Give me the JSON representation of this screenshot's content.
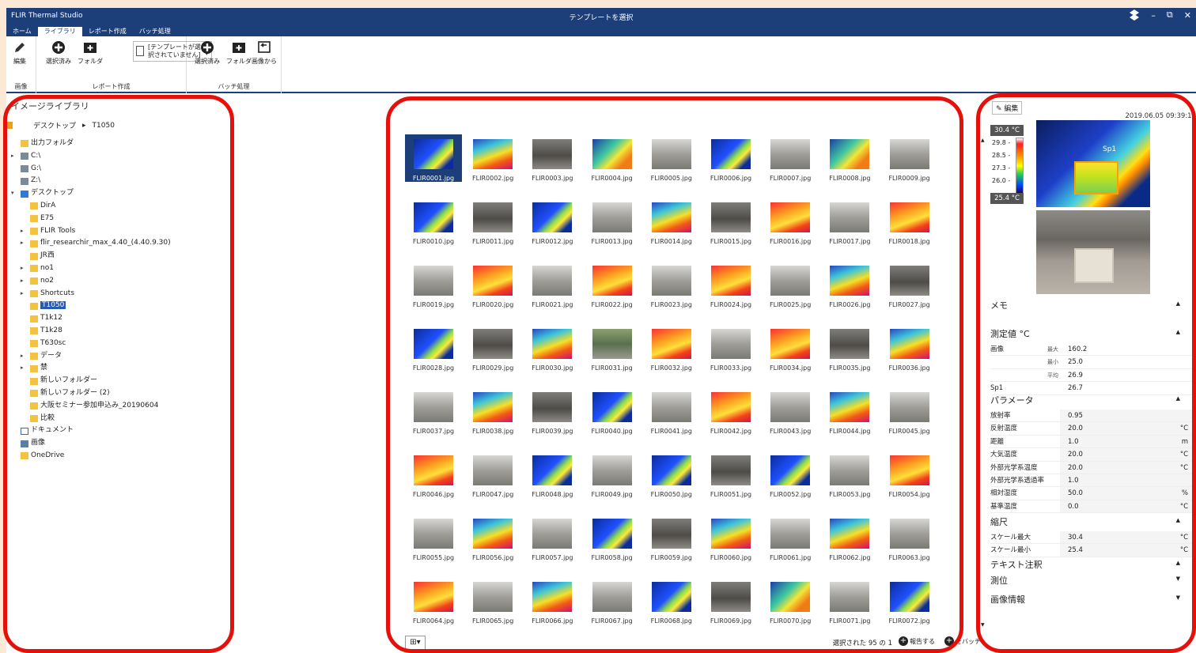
{
  "window": {
    "app_name": "FLIR Thermal Studio",
    "title": "テンプレートを選択",
    "controls": [
      "–",
      "⧉",
      "✕"
    ]
  },
  "menu": {
    "tabs": [
      "ホーム",
      "ライブラリ",
      "レポート作成",
      "バッチ処理"
    ],
    "active_index": 1
  },
  "ribbon": {
    "image_group": {
      "label": "画像",
      "edit": "編集"
    },
    "report_group": {
      "label": "レポート作成",
      "selected": "選択済み",
      "folder": "フォルダ",
      "template_line1": "[テンプレートが選",
      "template_line2": "択されていません]"
    },
    "batch_group": {
      "label": "バッチ処理",
      "selected": "選択済み",
      "folder": "フォルダ",
      "from_image": "画像から"
    }
  },
  "library": {
    "title": "イメージライブラリ",
    "breadcrumb": [
      "デスクトップ",
      "T1050"
    ]
  },
  "tree": [
    {
      "label": "出力フォルダ",
      "indent": 1,
      "arrow": "",
      "icon": "folder",
      "selected": false
    },
    {
      "label": "C:\\",
      "indent": 1,
      "arrow": "▸",
      "icon": "drive",
      "selected": false
    },
    {
      "label": "G:\\",
      "indent": 1,
      "arrow": "",
      "icon": "drive",
      "selected": false
    },
    {
      "label": "Z:\\",
      "indent": 1,
      "arrow": "",
      "icon": "drive",
      "selected": false
    },
    {
      "label": "デスクトップ",
      "indent": 1,
      "arrow": "▾",
      "icon": "desktop",
      "selected": false
    },
    {
      "label": "DirA",
      "indent": 2,
      "arrow": "",
      "icon": "folder",
      "selected": false
    },
    {
      "label": "E75",
      "indent": 2,
      "arrow": "",
      "icon": "folder",
      "selected": false
    },
    {
      "label": "FLIR Tools",
      "indent": 2,
      "arrow": "▸",
      "icon": "folder",
      "selected": false
    },
    {
      "label": "flir_researchir_max_4.40_(4.40.9.30)",
      "indent": 2,
      "arrow": "▸",
      "icon": "folder",
      "selected": false
    },
    {
      "label": "JR西",
      "indent": 2,
      "arrow": "",
      "icon": "folder",
      "selected": false
    },
    {
      "label": "no1",
      "indent": 2,
      "arrow": "▸",
      "icon": "folder",
      "selected": false
    },
    {
      "label": "no2",
      "indent": 2,
      "arrow": "▸",
      "icon": "folder",
      "selected": false
    },
    {
      "label": "Shortcuts",
      "indent": 2,
      "arrow": "▸",
      "icon": "folder",
      "selected": false
    },
    {
      "label": "T1050",
      "indent": 2,
      "arrow": "",
      "icon": "folder",
      "selected": true
    },
    {
      "label": "T1k12",
      "indent": 2,
      "arrow": "",
      "icon": "folder",
      "selected": false
    },
    {
      "label": "T1k28",
      "indent": 2,
      "arrow": "",
      "icon": "folder",
      "selected": false
    },
    {
      "label": "T630sc",
      "indent": 2,
      "arrow": "",
      "icon": "folder",
      "selected": false
    },
    {
      "label": "データ",
      "indent": 2,
      "arrow": "▸",
      "icon": "folder",
      "selected": false
    },
    {
      "label": "禁",
      "indent": 2,
      "arrow": "▸",
      "icon": "folder",
      "selected": false
    },
    {
      "label": "新しいフォルダー",
      "indent": 2,
      "arrow": "",
      "icon": "folder",
      "selected": false
    },
    {
      "label": "新しいフォルダー (2)",
      "indent": 2,
      "arrow": "",
      "icon": "folder",
      "selected": false
    },
    {
      "label": "大阪セミナー参加申込み_20190604",
      "indent": 2,
      "arrow": "",
      "icon": "folder",
      "selected": false
    },
    {
      "label": "比較",
      "indent": 2,
      "arrow": "",
      "icon": "folder",
      "selected": false
    },
    {
      "label": "ドキュメント",
      "indent": 1,
      "arrow": "",
      "icon": "doc",
      "selected": false
    },
    {
      "label": "画像",
      "indent": 1,
      "arrow": "",
      "icon": "pictures",
      "selected": false
    },
    {
      "label": "OneDrive",
      "indent": 1,
      "arrow": "",
      "icon": "folder",
      "selected": false
    }
  ],
  "thumbnails": [
    {
      "name": "FLIR0001.jpg",
      "kind": "thermal-blue"
    },
    {
      "name": "FLIR0002.jpg",
      "kind": "thermal-mix"
    },
    {
      "name": "FLIR0003.jpg",
      "kind": "photo-dark"
    },
    {
      "name": "FLIR0004.jpg",
      "kind": "thermal-green"
    },
    {
      "name": "FLIR0005.jpg",
      "kind": "photo-grey"
    },
    {
      "name": "FLIR0006.jpg",
      "kind": "thermal-blue"
    },
    {
      "name": "FLIR0007.jpg",
      "kind": "photo-grey"
    },
    {
      "name": "FLIR0008.jpg",
      "kind": "thermal-green"
    },
    {
      "name": "FLIR0009.jpg",
      "kind": "photo-grey"
    },
    {
      "name": "FLIR0010.jpg",
      "kind": "thermal-blue"
    },
    {
      "name": "FLIR0011.jpg",
      "kind": "photo-dark"
    },
    {
      "name": "FLIR0012.jpg",
      "kind": "thermal-blue"
    },
    {
      "name": "FLIR0013.jpg",
      "kind": "photo-grey"
    },
    {
      "name": "FLIR0014.jpg",
      "kind": "thermal-mix"
    },
    {
      "name": "FLIR0015.jpg",
      "kind": "photo-dark"
    },
    {
      "name": "FLIR0016.jpg",
      "kind": "thermal-red"
    },
    {
      "name": "FLIR0017.jpg",
      "kind": "photo-grey"
    },
    {
      "name": "FLIR0018.jpg",
      "kind": "thermal-red"
    },
    {
      "name": "FLIR0019.jpg",
      "kind": "photo-grey"
    },
    {
      "name": "FLIR0020.jpg",
      "kind": "thermal-red"
    },
    {
      "name": "FLIR0021.jpg",
      "kind": "photo-grey"
    },
    {
      "name": "FLIR0022.jpg",
      "kind": "thermal-red"
    },
    {
      "name": "FLIR0023.jpg",
      "kind": "photo-grey"
    },
    {
      "name": "FLIR0024.jpg",
      "kind": "thermal-red"
    },
    {
      "name": "FLIR0025.jpg",
      "kind": "photo-grey"
    },
    {
      "name": "FLIR0026.jpg",
      "kind": "thermal-mix"
    },
    {
      "name": "FLIR0027.jpg",
      "kind": "photo-dark"
    },
    {
      "name": "FLIR0028.jpg",
      "kind": "thermal-blue"
    },
    {
      "name": "FLIR0029.jpg",
      "kind": "photo-dark"
    },
    {
      "name": "FLIR0030.jpg",
      "kind": "thermal-mix"
    },
    {
      "name": "FLIR0031.jpg",
      "kind": "photo-green"
    },
    {
      "name": "FLIR0032.jpg",
      "kind": "thermal-red"
    },
    {
      "name": "FLIR0033.jpg",
      "kind": "photo-grey"
    },
    {
      "name": "FLIR0034.jpg",
      "kind": "thermal-red"
    },
    {
      "name": "FLIR0035.jpg",
      "kind": "photo-dark"
    },
    {
      "name": "FLIR0036.jpg",
      "kind": "thermal-mix"
    },
    {
      "name": "FLIR0037.jpg",
      "kind": "photo-grey"
    },
    {
      "name": "FLIR0038.jpg",
      "kind": "thermal-mix"
    },
    {
      "name": "FLIR0039.jpg",
      "kind": "photo-dark"
    },
    {
      "name": "FLIR0040.jpg",
      "kind": "thermal-blue"
    },
    {
      "name": "FLIR0041.jpg",
      "kind": "photo-grey"
    },
    {
      "name": "FLIR0042.jpg",
      "kind": "thermal-red"
    },
    {
      "name": "FLIR0043.jpg",
      "kind": "photo-grey"
    },
    {
      "name": "FLIR0044.jpg",
      "kind": "thermal-mix"
    },
    {
      "name": "FLIR0045.jpg",
      "kind": "photo-grey"
    },
    {
      "name": "FLIR0046.jpg",
      "kind": "thermal-red"
    },
    {
      "name": "FLIR0047.jpg",
      "kind": "photo-grey"
    },
    {
      "name": "FLIR0048.jpg",
      "kind": "thermal-blue"
    },
    {
      "name": "FLIR0049.jpg",
      "kind": "photo-grey"
    },
    {
      "name": "FLIR0050.jpg",
      "kind": "thermal-blue"
    },
    {
      "name": "FLIR0051.jpg",
      "kind": "photo-dark"
    },
    {
      "name": "FLIR0052.jpg",
      "kind": "thermal-blue"
    },
    {
      "name": "FLIR0053.jpg",
      "kind": "photo-grey"
    },
    {
      "name": "FLIR0054.jpg",
      "kind": "thermal-red"
    },
    {
      "name": "FLIR0055.jpg",
      "kind": "photo-grey"
    },
    {
      "name": "FLIR0056.jpg",
      "kind": "thermal-mix"
    },
    {
      "name": "FLIR0057.jpg",
      "kind": "photo-grey"
    },
    {
      "name": "FLIR0058.jpg",
      "kind": "thermal-blue"
    },
    {
      "name": "FLIR0059.jpg",
      "kind": "photo-dark"
    },
    {
      "name": "FLIR0060.jpg",
      "kind": "thermal-mix"
    },
    {
      "name": "FLIR0061.jpg",
      "kind": "photo-grey"
    },
    {
      "name": "FLIR0062.jpg",
      "kind": "thermal-mix"
    },
    {
      "name": "FLIR0063.jpg",
      "kind": "photo-grey"
    },
    {
      "name": "FLIR0064.jpg",
      "kind": "thermal-red"
    },
    {
      "name": "FLIR0065.jpg",
      "kind": "photo-grey"
    },
    {
      "name": "FLIR0066.jpg",
      "kind": "thermal-mix"
    },
    {
      "name": "FLIR0067.jpg",
      "kind": "photo-grey"
    },
    {
      "name": "FLIR0068.jpg",
      "kind": "thermal-blue"
    },
    {
      "name": "FLIR0069.jpg",
      "kind": "photo-dark"
    },
    {
      "name": "FLIR0070.jpg",
      "kind": "thermal-green"
    },
    {
      "name": "FLIR0071.jpg",
      "kind": "photo-grey"
    },
    {
      "name": "FLIR0072.jpg",
      "kind": "thermal-blue"
    }
  ],
  "bottom": {
    "view_icon": "grid-view-icon",
    "selection_text": "選択された 95 の 1",
    "add_report": "報告する",
    "add_batch": "をバッチ"
  },
  "details": {
    "edit_label": "編集",
    "timestamp": "2019.06.05 09:39:13",
    "scale": {
      "max": "30.4 °C",
      "min": "25.4 °C",
      "ticks": [
        "29.8 -",
        "28.5 -",
        "27.3 -",
        "26.0 -"
      ]
    },
    "spot_label": "Sp1",
    "memo_title": "メモ",
    "measurements_title": "測定値 °C",
    "measurements": [
      {
        "name": "画像",
        "sub": "最大",
        "value": "160.2"
      },
      {
        "name": "",
        "sub": "最小",
        "value": "25.0"
      },
      {
        "name": "",
        "sub": "平均",
        "value": "26.9"
      },
      {
        "name": "Sp1",
        "sub": "",
        "value": "26.7"
      }
    ],
    "params_title": "パラメータ",
    "params": [
      {
        "name": "放射率",
        "value": "0.95",
        "unit": ""
      },
      {
        "name": "反射温度",
        "value": "20.0",
        "unit": "°C"
      },
      {
        "name": "距離",
        "value": "1.0",
        "unit": "m"
      },
      {
        "name": "大気温度",
        "value": "20.0",
        "unit": "°C"
      },
      {
        "name": "外部光学系温度",
        "value": "20.0",
        "unit": "°C"
      },
      {
        "name": "外部光学系透過率",
        "value": "1.0",
        "unit": ""
      },
      {
        "name": "相対湿度",
        "value": "50.0",
        "unit": "%"
      },
      {
        "name": "基準温度",
        "value": "0.0",
        "unit": "°C"
      }
    ],
    "scale_title": "縮尺",
    "scale_rows": [
      {
        "name": "スケール最大",
        "value": "30.4",
        "unit": "°C"
      },
      {
        "name": "スケール最小",
        "value": "25.4",
        "unit": "°C"
      }
    ],
    "text_annotation_title": "テキスト注釈",
    "measure_title": "測位",
    "image_info_title": "画像情報"
  },
  "colors": {
    "titlebar": "#1c3f7a",
    "selection": "#2a5ab0",
    "annotation_red": "#e5100a"
  }
}
